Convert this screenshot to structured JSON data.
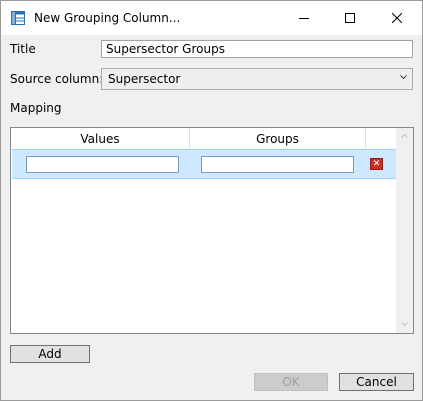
{
  "window": {
    "title": "New Grouping Column...",
    "icon": "table-icon",
    "controls": [
      "minimize-icon",
      "maximize-icon",
      "close-icon"
    ]
  },
  "form": {
    "title_label": "Title",
    "title_value": "Supersector Groups",
    "source_label": "Source column:",
    "source_value": "Supersector",
    "mapping_label": "Mapping"
  },
  "grid": {
    "columns": [
      "Values",
      "Groups"
    ],
    "rows": [
      {
        "value": "",
        "group": ""
      }
    ]
  },
  "buttons": {
    "add": "Add",
    "ok": "OK",
    "cancel": "Cancel"
  }
}
